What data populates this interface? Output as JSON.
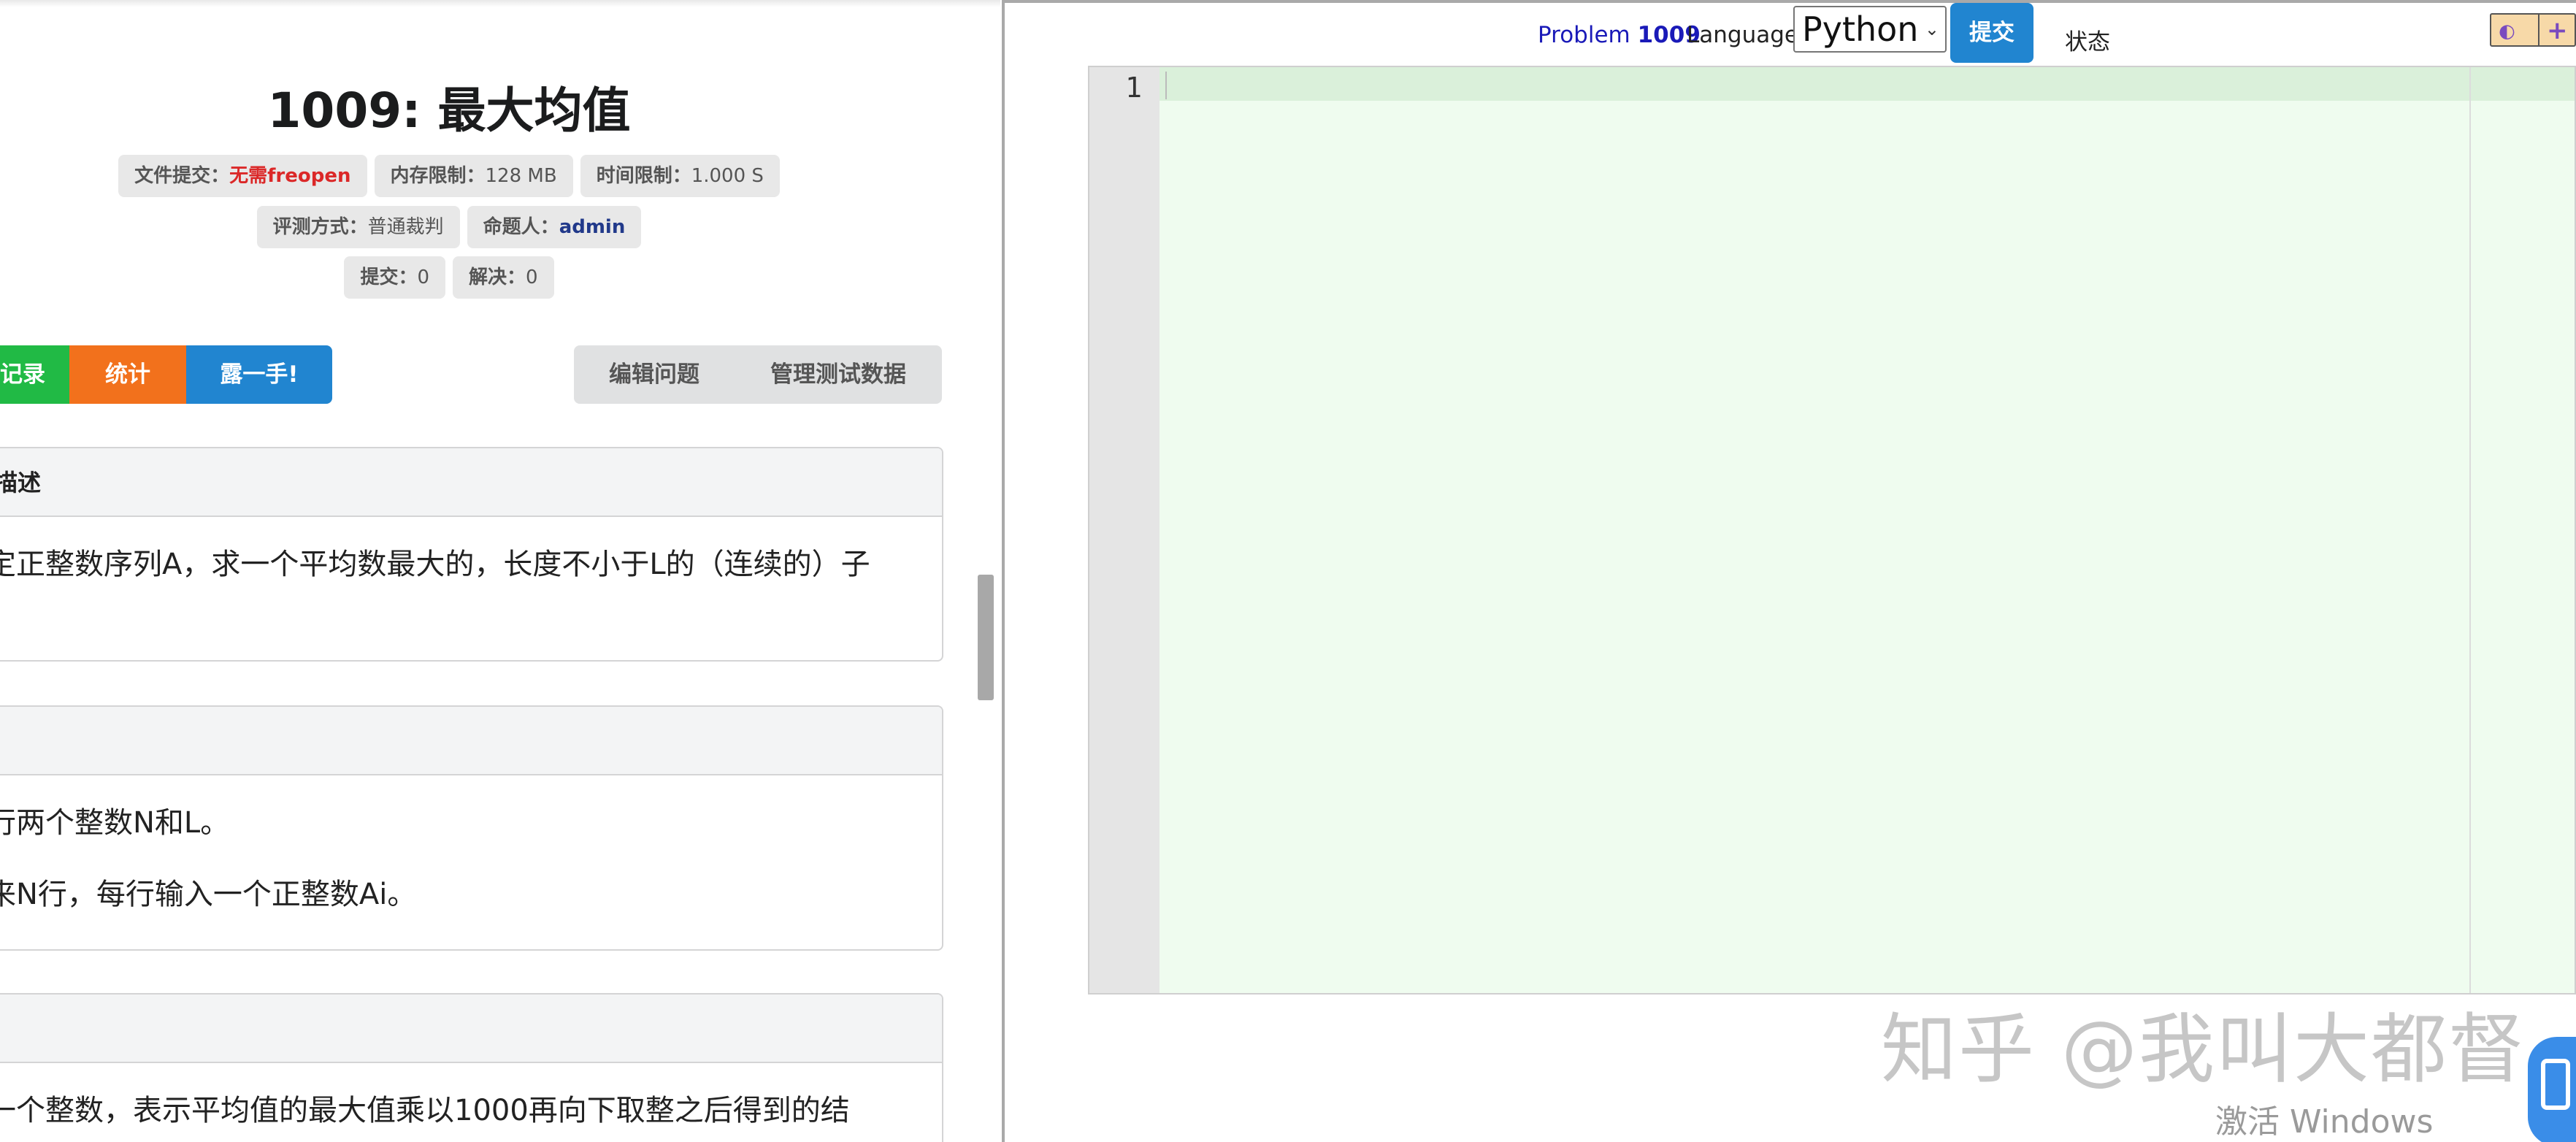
{
  "problem": {
    "title": "1009: 最大均值",
    "labels": {
      "file_key": "文件提交：",
      "file_val": "无需freopen",
      "mem_key": "内存限制：",
      "mem_val": "128 MB",
      "time_key": "时间限制：",
      "time_val": "1.000 S",
      "judge_key": "评测方式：",
      "judge_val": "普通裁判",
      "author_key": "命题人：",
      "author_val": "admin",
      "submit_key": "提交：",
      "submit_val": "0",
      "solved_key": "解决：",
      "solved_val": "0"
    }
  },
  "buttons_left": {
    "records": "记录",
    "stats": "统计",
    "show": "露一手!"
  },
  "buttons_right": {
    "edit": "编辑问题",
    "manage": "管理测试数据"
  },
  "sections": {
    "description": {
      "head": "描述",
      "text": "定正整数序列A，求一个平均数最大的，长度不小于L的（连续的）子"
    },
    "input": {
      "line1": "行两个整数N和L。",
      "line2": "来N行，每行输入一个正整数Ai。"
    },
    "output": {
      "text": "一个整数，表示平均值的最大值乘以1000再向下取整之后得到的结"
    }
  },
  "toolbar": {
    "problem_prefix": "Problem",
    "problem_num": "1009",
    "language_label": "Language:",
    "language_value": "Python",
    "submit": "提交",
    "status": "状态"
  },
  "editor": {
    "line_number": "1"
  },
  "watermark": {
    "zhihu": "知乎 @我叫大都督",
    "windows": "激活 Windows"
  },
  "colors": {
    "green": "#21ba45",
    "orange": "#f2711c",
    "blue": "#2185d0",
    "red_text": "#db2828",
    "editor_bg": "#effcef"
  }
}
